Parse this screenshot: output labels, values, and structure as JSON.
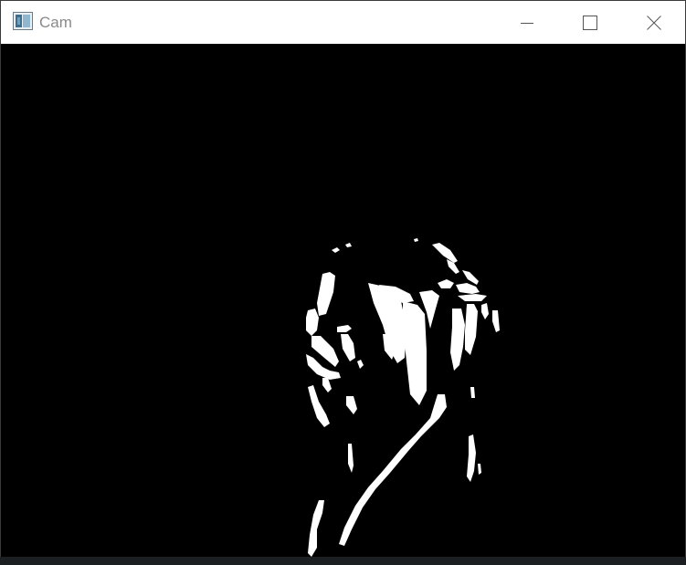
{
  "window": {
    "title": "Cam",
    "icon": "opencv-window-icon",
    "controls": {
      "minimize_icon": "minimize-icon",
      "maximize_icon": "maximize-icon",
      "close_icon": "close-icon"
    }
  },
  "camera": {
    "image": "binary-threshold-mask",
    "colors": {
      "background": "#000000",
      "foreground": "#ffffff"
    }
  }
}
